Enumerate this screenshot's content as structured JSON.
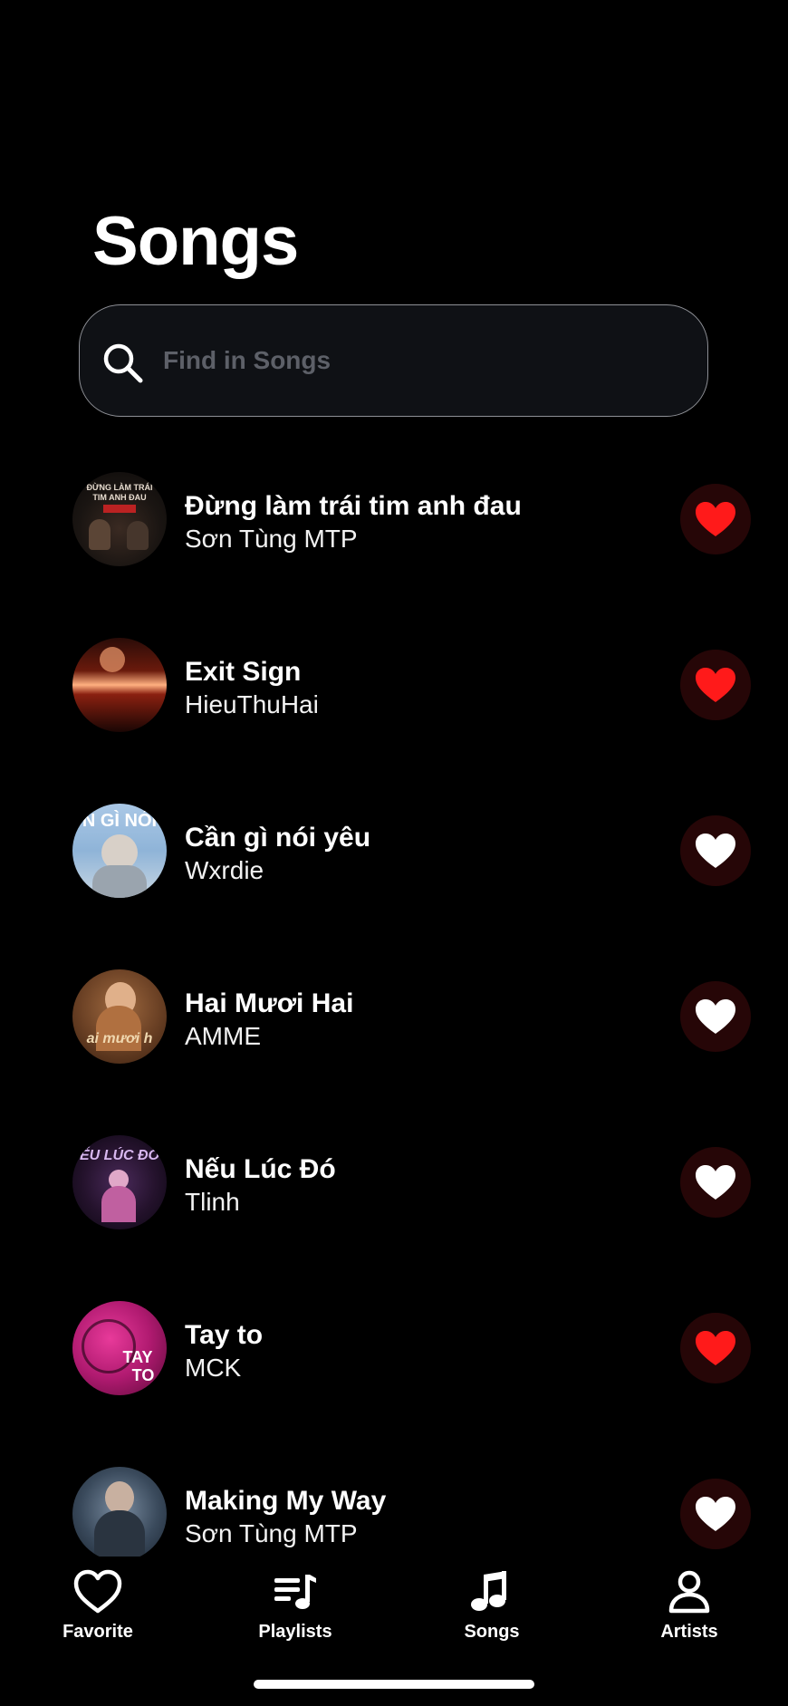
{
  "header": {
    "title": "Songs"
  },
  "search": {
    "placeholder": "Find in Songs",
    "value": ""
  },
  "songs": [
    {
      "title": "Đừng làm trái tim anh đau",
      "artist": "Sơn Tùng MTP",
      "favorite": true
    },
    {
      "title": "Exit Sign",
      "artist": "HieuThuHai",
      "favorite": true
    },
    {
      "title": "Cần gì nói yêu",
      "artist": "Wxrdie",
      "favorite": false
    },
    {
      "title": "Hai Mươi Hai",
      "artist": "AMME",
      "favorite": false
    },
    {
      "title": "Nếu Lúc Đó",
      "artist": "Tlinh",
      "favorite": false
    },
    {
      "title": "Tay to",
      "artist": "MCK",
      "favorite": true
    },
    {
      "title": "Making My Way",
      "artist": "Sơn Tùng MTP",
      "favorite": false
    }
  ],
  "tabs": [
    {
      "label": "Favorite",
      "icon": "heart-icon"
    },
    {
      "label": "Playlists",
      "icon": "playlist-icon"
    },
    {
      "label": "Songs",
      "icon": "music-note-icon"
    },
    {
      "label": "Artists",
      "icon": "person-icon"
    }
  ],
  "colors": {
    "background": "#000000",
    "heart_active": "#ff1a1a",
    "heart_inactive": "#ffffff",
    "heart_button_bg": "#260607",
    "search_placeholder": "#5d6068"
  }
}
